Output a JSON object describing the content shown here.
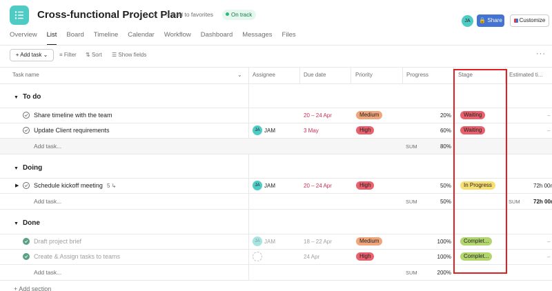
{
  "project": {
    "title": "Cross-functional Project Plan",
    "favorite_label": "Add to favorites",
    "status_label": "On track",
    "share_label": "Share",
    "customize_label": "Customize",
    "avatar_initials": "JA"
  },
  "tabs": [
    "Overview",
    "List",
    "Board",
    "Timeline",
    "Calendar",
    "Workflow",
    "Dashboard",
    "Messages",
    "Files"
  ],
  "toolbar": {
    "add_task": "Add task",
    "filter": "Filter",
    "sort": "Sort",
    "show_fields": "Show fields"
  },
  "columns": {
    "task_name": "Task name",
    "assignee": "Assignee",
    "due_date": "Due date",
    "priority": "Priority",
    "progress": "Progress",
    "stage": "Stage",
    "estimated": "Estimated ti..."
  },
  "colors": {
    "accent": "#4573d2",
    "medium": "#f1bd6c",
    "high": "#e8384f",
    "waiting": "#e8384f",
    "in_progress": "#f8df72",
    "complete": "#b3d56e",
    "highlight": "#e02020",
    "overdue": "#c92f54"
  },
  "sections": {
    "todo": {
      "label": "To do",
      "tasks": [
        {
          "name": "Share timeline with the team",
          "assignee": "",
          "due": "20 – 24 Apr",
          "priority": "Medium",
          "progress": "20%",
          "stage": "Waiting",
          "estimated": "–"
        },
        {
          "name": "Update Client requirements",
          "assignee_initials": "JA",
          "assignee": "JAM",
          "due": "3 May",
          "priority": "High",
          "progress": "60%",
          "stage": "Waiting",
          "estimated": "–"
        }
      ],
      "add_task": "Add task...",
      "sum_label": "SUM",
      "sum_value": "80%"
    },
    "doing": {
      "label": "Doing",
      "tasks": [
        {
          "name": "Schedule kickoff meeting",
          "subtasks": "5",
          "assignee_initials": "JA",
          "assignee": "JAM",
          "due": "20 – 24 Apr",
          "priority": "High",
          "progress": "50%",
          "stage": "In Progress",
          "estimated": "72h 00m"
        }
      ],
      "add_task": "Add task...",
      "sum_label": "SUM",
      "sum_value": "50%",
      "est_sum_label": "SUM",
      "est_sum_value": "72h 00m"
    },
    "done": {
      "label": "Done",
      "tasks": [
        {
          "name": "Draft project brief",
          "assignee_initials": "JA",
          "assignee": "JAM",
          "due": "18 – 22 Apr",
          "priority": "Medium",
          "progress": "100%",
          "stage": "Complet...",
          "estimated": "–"
        },
        {
          "name": "Create & Assign tasks to teams",
          "assignee": "",
          "due": "24 Apr",
          "priority": "High",
          "progress": "100%",
          "stage": "Complet...",
          "estimated": "–"
        }
      ],
      "add_task": "Add task...",
      "sum_label": "SUM",
      "sum_value": "200%"
    }
  },
  "add_section": "Add section"
}
